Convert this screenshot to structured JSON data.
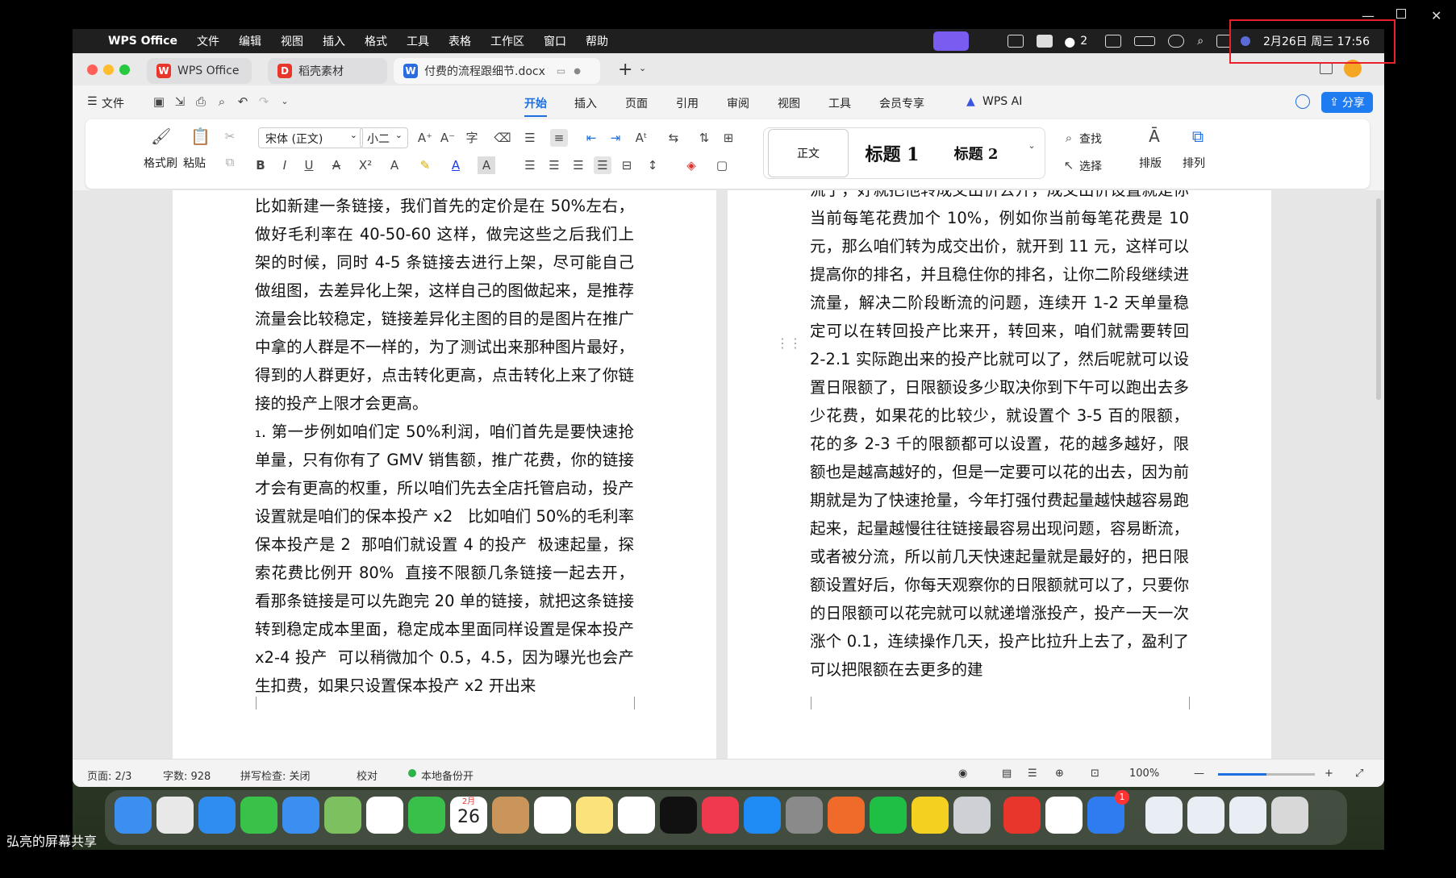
{
  "menubar": {
    "app_name": "WPS Office",
    "items": [
      "文件",
      "编辑",
      "视图",
      "插入",
      "格式",
      "工具",
      "表格",
      "工作区",
      "窗口",
      "帮助"
    ],
    "wechat_badge": "2",
    "datetime": "2月26日 周三  17:56"
  },
  "tabs": [
    {
      "label": "WPS Office"
    },
    {
      "label": "稻壳素材"
    },
    {
      "label": "付费的流程跟细节.docx"
    }
  ],
  "toolbar1": {
    "file_label": "文件",
    "ribbon_tabs": [
      "开始",
      "插入",
      "页面",
      "引用",
      "审阅",
      "视图",
      "工具",
      "会员专享"
    ],
    "wps_ai": "WPS AI",
    "share": "分享"
  },
  "ribbon": {
    "format_painter": "格式刷",
    "paste": "粘贴",
    "font_name": "宋体 (正文)",
    "font_size": "小二",
    "style_normal": "正文",
    "style_h1": "标题 1",
    "style_h2": "标题 2",
    "find": "查找",
    "select": "选择",
    "layout": "排版",
    "arrange": "排列"
  },
  "document": {
    "left_page": "比如新建一条链接，我们首先的定价是在 50%左右，做好毛利率在 40-50-60 这样，做完这些之后我们上架的时候，同时 4-5 条链接去进行上架，尽可能自己做组图，去差异化上架，这样自己的图做起来，是推荐流量会比较稳定，链接差异化主图的目的是图片在推广中拿的人群是不一样的，为了测试出来那种图片最好，得到的人群更好，点击转化更高，点击转化上来了你链接的投产上限才会更高。\n₁. 第一步例如咱们定 50%利润，咱们首先是要快速抢单量，只有你有了 GMV 销售额，推广花费，你的链接才会有更高的权重，所以咱们先去全店托管启动，投产设置就是咱们的保本投产 x2   比如咱们 50%的毛利率保本投产是 2  那咱们就设置 4 的投产  极速起量，探索花费比例开 80%  直接不限额几条链接一起去开，看那条链接是可以先跑完 20 单的链接，就把这条链接转到稳定成本里面，稳定成本里面同样设置是保本投产 x2-4 投产  可以稍微加个 0.5，4.5，因为曝光也会产生扣费，如果只设置保本投产 x2 开出来",
    "right_page": "流了，好就把他转成交出价去开，成交出价设置就是你当前每笔花费加个 10%，例如你当前每笔花费是 10 元，那么咱们转为成交出价，就开到 11 元，这样可以提高你的排名，并且稳住你的排名，让你二阶段继续进流量，解决二阶段断流的问题，连续开 1-2 天单量稳定可以在转回投产比来开，转回来，咱们就需要转回 2-2.1 实际跑出来的投产比就可以了，然后呢就可以设置日限额了，日限额设多少取决你到下午可以跑出去多少花费，如果花的比较少，就设置个 3-5 百的限额，花的多 2-3 千的限额都可以设置，花的越多越好，限额也是越高越好的，但是一定要可以花的出去，因为前期就是为了快速抢量，今年打强付费起量越快越容易跑起来，起量越慢往往链接最容易出现问题，容易断流，或者被分流，所以前几天快速起量就是最好的，把日限额设置好后，你每天观察你的日限额就可以了，只要你的日限额可以花完就可以就递增涨投产，投产一天一次涨个 0.1，连续操作几天，投产比拉升上去了，盈利了可以把限额在去更多的建"
  },
  "statusbar": {
    "page": "页面: 2/3",
    "words": "字数: 928",
    "spell": "拼写检查: 关闭",
    "proof": "校对",
    "backup": "本地备份开",
    "zoom": "100%"
  },
  "dock": {
    "calendar_month": "2月",
    "calendar_day": "26",
    "badge": "1"
  },
  "caption": "弘亮的屏幕共享"
}
